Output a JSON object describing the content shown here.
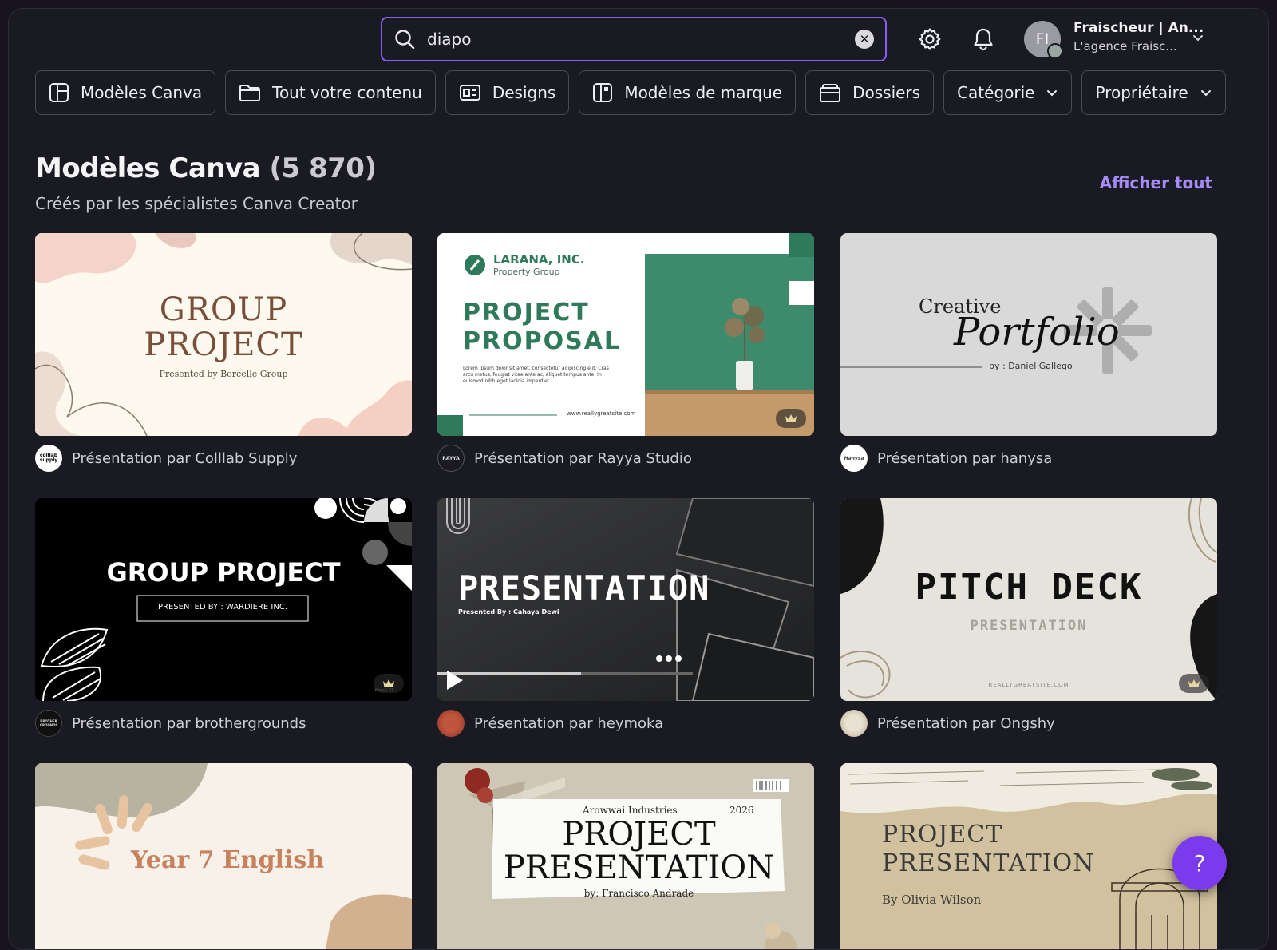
{
  "search": {
    "value": "diapo"
  },
  "account": {
    "initials": "FI",
    "name": "Fraischeur | An...",
    "org": "L'agence Fraisc..."
  },
  "chips": [
    {
      "label": "Modèles Canva",
      "icon": "template-icon"
    },
    {
      "label": "Tout votre contenu",
      "icon": "folder-icon"
    },
    {
      "label": "Designs",
      "icon": "design-icon"
    },
    {
      "label": "Modèles de marque",
      "icon": "brand-template-icon"
    },
    {
      "label": "Dossiers",
      "icon": "folders-icon"
    },
    {
      "label": "Catégorie",
      "icon": "chevron-down-icon"
    },
    {
      "label": "Propriétaire",
      "icon": "chevron-down-icon"
    }
  ],
  "section": {
    "title": "Modèles Canva",
    "count": "(5 870)",
    "subtitle": "Créés par les spécialistes Canva Creator",
    "show_all": "Afficher tout"
  },
  "cards": [
    {
      "author_text": "Présentation par Colllab Supply",
      "avatar_text": "colllab supply",
      "thumb": {
        "line1": "GROUP",
        "line2": "PROJECT",
        "line3": "Presented by Borcelle Group"
      }
    },
    {
      "author_text": "Présentation par Rayya Studio",
      "avatar_text": "RAYYA",
      "thumb": {
        "line1": "LARANA, INC.",
        "line2": "Property Group",
        "line3": "PROJECT",
        "line4": "PROPOSAL",
        "body": "Lorem ipsum dolor sit amet, consectetur adipiscing elit. Cras arcu metus, feugiat vitae ante ac, aliquet tempus ante. In euismod nibh eget lacinia imperdiet.",
        "url": "www.reallygreatsite.com"
      }
    },
    {
      "author_text": "Présentation par hanysa",
      "avatar_text": "Hanysa",
      "thumb": {
        "line1": "Creative",
        "line2": "Portfolio",
        "line3": "by : Daniel Gallego"
      }
    },
    {
      "author_text": "Présentation par brothergrounds",
      "avatar_text": "BROTHER GROUNDS",
      "thumb": {
        "line1": "GROUP PROJECT",
        "line2": "PRESENTED BY : WARDIERE INC.",
        "line3": "Page | 01"
      }
    },
    {
      "author_text": "Présentation par heymoka",
      "avatar_text": "",
      "thumb": {
        "line1": "PRESENTATION",
        "line2": "Presented By : Cahaya Dewi"
      }
    },
    {
      "author_text": "Présentation par Ongshy",
      "avatar_text": "",
      "thumb": {
        "line1": "PITCH DECK",
        "line2": "PRESENTATION",
        "line3": "REALLYGREATSITE.COM"
      }
    },
    {
      "author_text": "",
      "avatar_text": "",
      "thumb": {
        "line1": "Year 7 English"
      }
    },
    {
      "author_text": "",
      "avatar_text": "",
      "thumb": {
        "line1": "Arowwai Industries",
        "line2": "2026",
        "line3": "PROJECT",
        "line4": "PRESENTATION",
        "line5": "by: Francisco Andrade"
      }
    },
    {
      "author_text": "",
      "avatar_text": "",
      "thumb": {
        "line1": "PROJECT",
        "line2": "PRESENTATION",
        "line3": "By Olivia Wilson"
      }
    }
  ],
  "help": {
    "label": "?"
  },
  "colors": {
    "accent": "#8b5cf6",
    "link": "#a78bfa",
    "help_button": "#7c3aed"
  }
}
